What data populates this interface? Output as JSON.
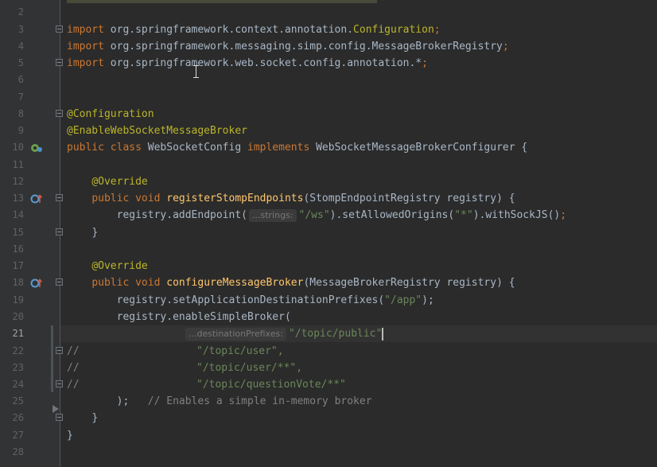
{
  "editor": {
    "active_line": 21,
    "line_numbers": [
      "2",
      "3",
      "4",
      "5",
      "6",
      "7",
      "8",
      "9",
      "10",
      "11",
      "12",
      "13",
      "14",
      "15",
      "16",
      "17",
      "18",
      "19",
      "20",
      "21",
      "22",
      "23",
      "24",
      "25",
      "26",
      "27",
      "28"
    ]
  },
  "code": {
    "l3_kw": "import",
    "l3_pkg": " org.springframework.context.annotation.",
    "l3_cls": "Configuration",
    "l3_end": ";",
    "l4_kw": "import",
    "l4_pkg": " org.springframework.messaging.simp.config.MessageBrokerRegistry",
    "l4_end": ";",
    "l5_kw": "import",
    "l5_pkg": " org.springframework.web.socket.config.annotation.*",
    "l5_end": ";",
    "l8_ann": "@Configuration",
    "l9_ann": "@EnableWebSocketMessageBroker",
    "l10_public": "public ",
    "l10_class": "class ",
    "l10_name": "WebSocketConfig ",
    "l10_impl": "implements ",
    "l10_iface": "WebSocketMessageBrokerConfigurer {",
    "l12_ann": "@Override",
    "l13_public": "public ",
    "l13_void": "void ",
    "l13_fn": "registerStompEndpoints",
    "l13_params": "(StompEndpointRegistry registry) {",
    "l14_call": "registry.addEndpoint(",
    "l14_hint": "...strings:",
    "l14_str1": "\"/ws\"",
    "l14_mid": ").setAllowedOrigins(",
    "l14_str2": "\"*\"",
    "l14_end1": ").withSockJS()",
    "l14_semi": ";",
    "l15": "}",
    "l17_ann": "@Override",
    "l18_public": "public ",
    "l18_void": "void ",
    "l18_fn": "configureMessageBroker",
    "l18_params": "(MessageBrokerRegistry registry) {",
    "l19_call": "registry.setApplicationDestinationPrefixes(",
    "l19_str": "\"/app\"",
    "l19_end": ");",
    "l20_call": "registry.enableSimpleBroker(",
    "l21_hint": "...destinationPrefixes:",
    "l21_str": "\"/topic/public\"",
    "l22_cmt": "//",
    "l22_str": "\"/topic/user\",",
    "l23_cmt": "//",
    "l23_str": "\"/topic/user/**\",",
    "l24_cmt": "//",
    "l24_str": "\"/topic/questionVote/**\"",
    "l25_close": ");",
    "l25_cmt": "// Enables a simple in-memory broker",
    "l26": "}",
    "l27": "}"
  },
  "icons": {
    "l10": "spring-bean-icon",
    "l13": "override-method-icon",
    "l18": "override-method-icon"
  },
  "colors": {
    "background": "#2b2b2b",
    "gutter": "#313335",
    "keyword": "#cc7832",
    "annotation": "#bbb529",
    "string": "#6a8759",
    "comment": "#808080",
    "function": "#ffc66d",
    "text": "#a9b7c6"
  }
}
